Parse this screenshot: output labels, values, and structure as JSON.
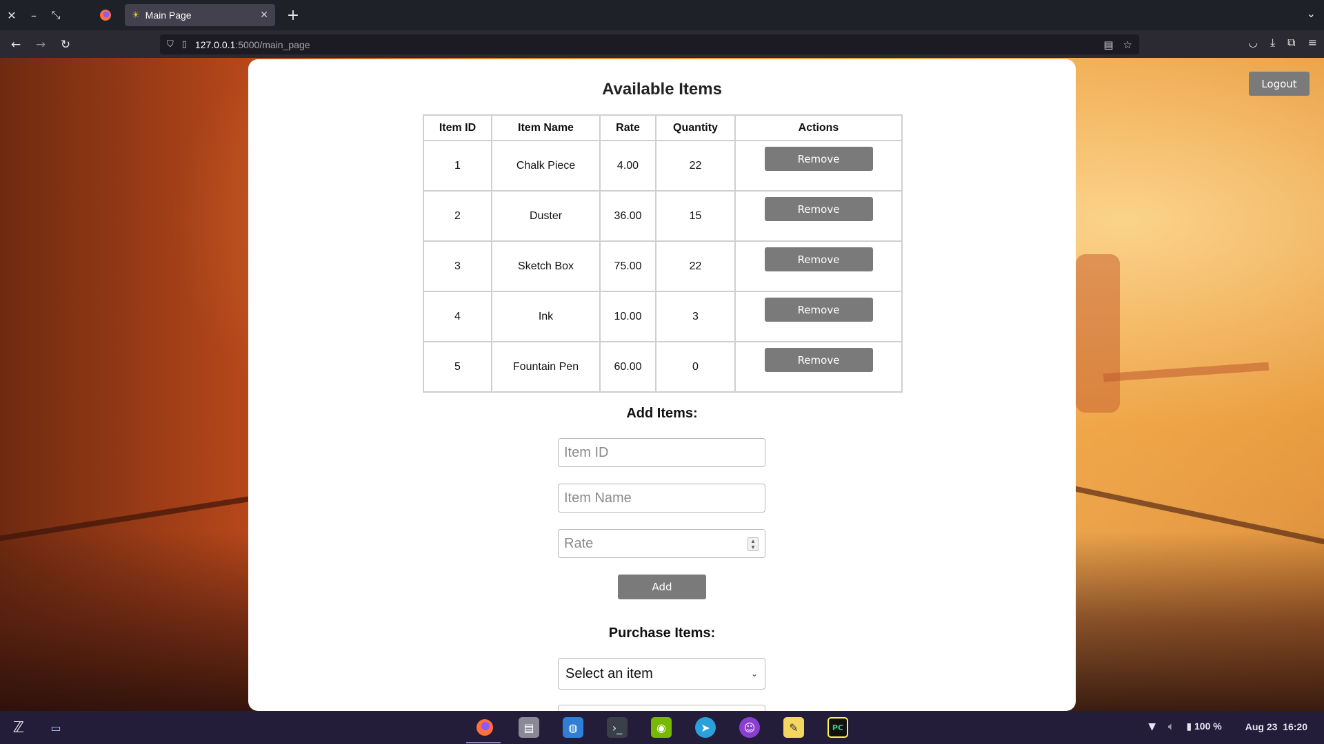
{
  "browser": {
    "tab_title": "Main Page",
    "url_host": "127.0.0.1",
    "url_path": ":5000/main_page"
  },
  "page": {
    "logout_label": "Logout",
    "available_title": "Available Items",
    "table": {
      "headers": [
        "Item ID",
        "Item Name",
        "Rate",
        "Quantity",
        "Actions"
      ],
      "rows": [
        {
          "id": "1",
          "name": "Chalk Piece",
          "rate": "4.00",
          "quantity": "22",
          "action": "Remove"
        },
        {
          "id": "2",
          "name": "Duster",
          "rate": "36.00",
          "quantity": "15",
          "action": "Remove"
        },
        {
          "id": "3",
          "name": "Sketch Box",
          "rate": "75.00",
          "quantity": "22",
          "action": "Remove"
        },
        {
          "id": "4",
          "name": "Ink",
          "rate": "10.00",
          "quantity": "3",
          "action": "Remove"
        },
        {
          "id": "5",
          "name": "Fountain Pen",
          "rate": "60.00",
          "quantity": "0",
          "action": "Remove"
        }
      ]
    },
    "add_section": {
      "title": "Add Items:",
      "item_id_placeholder": "Item ID",
      "item_name_placeholder": "Item Name",
      "rate_placeholder": "Rate",
      "add_label": "Add"
    },
    "purchase_section": {
      "title": "Purchase Items:",
      "select_value": "Select an item"
    }
  },
  "taskbar": {
    "battery": "100 %",
    "date": "Aug 23",
    "time": "16:20"
  },
  "colors": {
    "button_gray": "#7a7a7a",
    "tab_bg": "#42414d",
    "taskbar_bg": "#231d3a"
  }
}
